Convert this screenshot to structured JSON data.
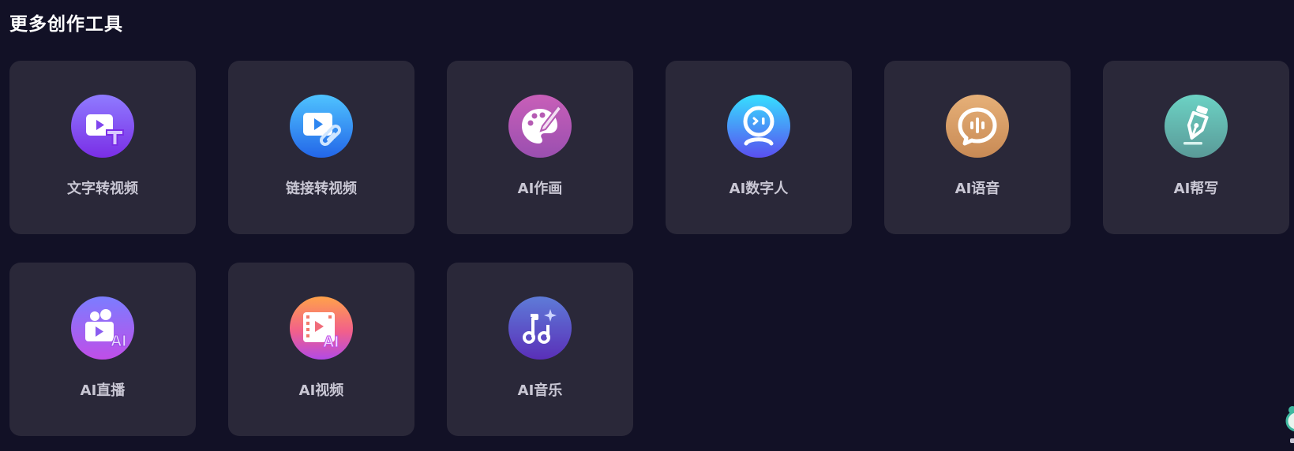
{
  "section": {
    "title": "更多创作工具"
  },
  "tools": [
    {
      "label": "文字转视频",
      "icon": "text-to-video-icon"
    },
    {
      "label": "链接转视频",
      "icon": "link-to-video-icon"
    },
    {
      "label": "AI作画",
      "icon": "palette-icon"
    },
    {
      "label": "AI数字人",
      "icon": "digital-human-icon"
    },
    {
      "label": "AI语音",
      "icon": "voice-bubble-icon"
    },
    {
      "label": "AI帮写",
      "icon": "pen-write-icon"
    },
    {
      "label": "AI直播",
      "icon": "live-stream-icon"
    },
    {
      "label": "AI视频",
      "icon": "film-ai-icon"
    },
    {
      "label": "AI音乐",
      "icon": "music-note-icon"
    }
  ],
  "colors": {
    "background": "#121126",
    "card": "#2a2839",
    "label": "#c9c7d4",
    "title": "#ffffff"
  }
}
